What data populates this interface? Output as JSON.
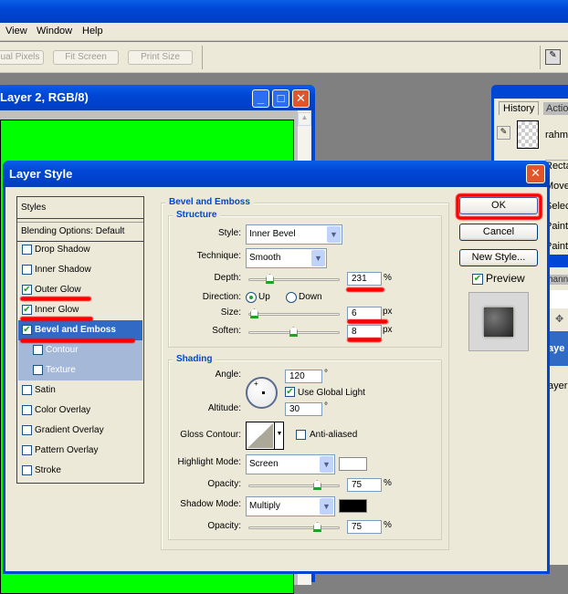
{
  "menu": {
    "items": [
      "View",
      "Window",
      "Help"
    ]
  },
  "toolbar": {
    "buttons": [
      "ual Pixels",
      "Fit Screen",
      "Print Size"
    ]
  },
  "document": {
    "title": "Layer 2, RGB/8)",
    "canvas_color": "#00ff00"
  },
  "history_panel": {
    "tabs": [
      "History",
      "Actio"
    ],
    "snapshot": "rahme",
    "items": [
      "Rectar",
      "Move",
      "Select",
      "Paint",
      "Paint"
    ]
  },
  "layers_panel": {
    "tab": "hann",
    "items": [
      "aye",
      "ayer"
    ]
  },
  "dialog": {
    "title": "Layer Style",
    "styles_header": "Styles",
    "blending": "Blending Options: Default",
    "styles": [
      {
        "label": "Drop Shadow",
        "checked": false
      },
      {
        "label": "Inner Shadow",
        "checked": false
      },
      {
        "label": "Outer Glow",
        "checked": true
      },
      {
        "label": "Inner Glow",
        "checked": true
      },
      {
        "label": "Bevel and Emboss",
        "checked": true,
        "selected": true
      },
      {
        "label": "Contour",
        "checked": false,
        "sub": true
      },
      {
        "label": "Texture",
        "checked": false,
        "sub": true
      },
      {
        "label": "Satin",
        "checked": false
      },
      {
        "label": "Color Overlay",
        "checked": false
      },
      {
        "label": "Gradient Overlay",
        "checked": false
      },
      {
        "label": "Pattern Overlay",
        "checked": false
      },
      {
        "label": "Stroke",
        "checked": false
      }
    ],
    "section": "Bevel and Emboss",
    "structure": {
      "title": "Structure",
      "style_label": "Style:",
      "style": "Inner Bevel",
      "technique_label": "Technique:",
      "technique": "Smooth",
      "depth_label": "Depth:",
      "depth": "231",
      "depth_unit": "%",
      "direction_label": "Direction:",
      "up": "Up",
      "down": "Down",
      "direction": "Up",
      "size_label": "Size:",
      "size": "6",
      "size_unit": "px",
      "soften_label": "Soften:",
      "soften": "8",
      "soften_unit": "px"
    },
    "shading": {
      "title": "Shading",
      "angle_label": "Angle:",
      "angle": "120",
      "deg": "°",
      "global_light": "Use Global Light",
      "global_checked": true,
      "altitude_label": "Altitude:",
      "altitude": "30",
      "gloss_label": "Gloss Contour:",
      "anti_aliased": "Anti-aliased",
      "anti_checked": false,
      "highlight_label": "Highlight Mode:",
      "highlight_mode": "Screen",
      "highlight_color": "#ffffff",
      "opacity_label": "Opacity:",
      "highlight_opacity": "75",
      "pct": "%",
      "shadow_label": "Shadow Mode:",
      "shadow_mode": "Multiply",
      "shadow_color": "#000000",
      "shadow_opacity": "75"
    },
    "buttons": {
      "ok": "OK",
      "cancel": "Cancel",
      "new_style": "New Style..."
    },
    "preview": {
      "label": "Preview",
      "checked": true
    },
    "annotation_color": "#ff0000"
  }
}
